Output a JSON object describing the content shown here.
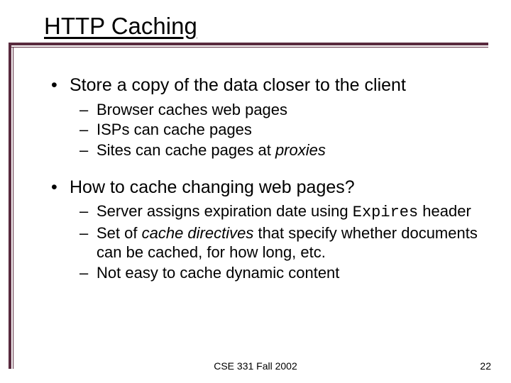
{
  "title": "HTTP Caching",
  "b1": "Store a copy of the data closer to the client",
  "b1s1": "Browser caches web pages",
  "b1s2": "ISPs can cache pages",
  "b1s3_a": "Sites can cache pages at ",
  "b1s3_b": "proxies",
  "b2": "How to cache changing web pages?",
  "b2s1_a": "Server assigns expiration date using ",
  "b2s1_b": "Expires",
  "b2s1_c": " header",
  "b2s2_a": "Set of ",
  "b2s2_b": "cache directives",
  "b2s2_c": " that specify whether documents can be cached, for how long, etc.",
  "b2s3": "Not easy to cache dynamic content",
  "footer_center": "CSE 331 Fall 2002",
  "footer_right": "22"
}
